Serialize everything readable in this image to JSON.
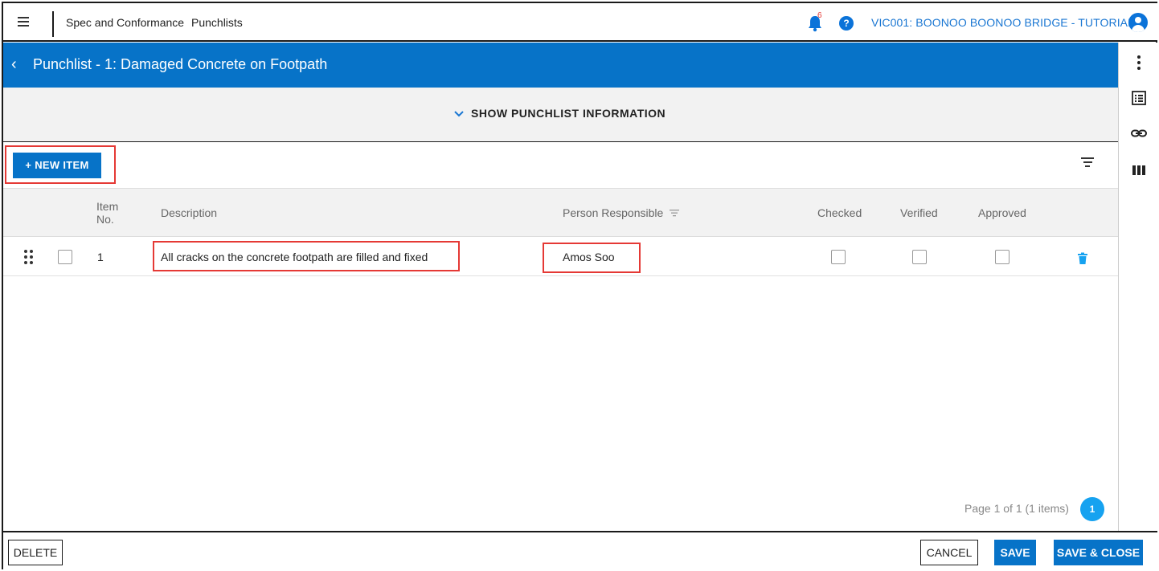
{
  "header": {
    "breadcrumb_module": "Spec and Conformance",
    "breadcrumb_page": "Punchlists",
    "notification_count": "6",
    "help_glyph": "?",
    "project_name": "VIC001: BOONOO BOONOO BRIDGE - TUTORIAL"
  },
  "titlebar": {
    "back_glyph": "‹",
    "title": "Punchlist - 1: Damaged Concrete on Footpath"
  },
  "info_toggle": {
    "chevron": "⌄",
    "label": "SHOW PUNCHLIST INFORMATION"
  },
  "toolbar": {
    "new_item_label": "+  NEW ITEM"
  },
  "table": {
    "headers": {
      "item_no": "Item No.",
      "description": "Description",
      "person_responsible": "Person Responsible",
      "checked": "Checked",
      "verified": "Verified",
      "approved": "Approved"
    },
    "rows": [
      {
        "item_no": "1",
        "description": "All cracks on the concrete footpath are filled and fixed",
        "person_responsible": "Amos Soo",
        "checked": false,
        "verified": false,
        "approved": false
      }
    ]
  },
  "pagination": {
    "info": "Page 1 of 1 (1 items)",
    "current_page": "1"
  },
  "footer": {
    "delete_label": "DELETE",
    "cancel_label": "CANCEL",
    "save_label": "SAVE",
    "save_close_label": "SAVE & CLOSE"
  },
  "colors": {
    "primary": "#0773c8",
    "highlight": "#e53935",
    "page_badge": "#16a2f0"
  },
  "icons": {
    "menu": "hamburger-menu-icon",
    "bell": "bell-icon",
    "help": "help-circle-icon",
    "account": "account-circle-icon",
    "more": "more-vertical-icon",
    "list": "list-details-icon",
    "link": "link-icon",
    "columns": "columns-icon",
    "filter": "filter-icon",
    "drag": "drag-handle-icon",
    "delete": "trash-icon"
  }
}
